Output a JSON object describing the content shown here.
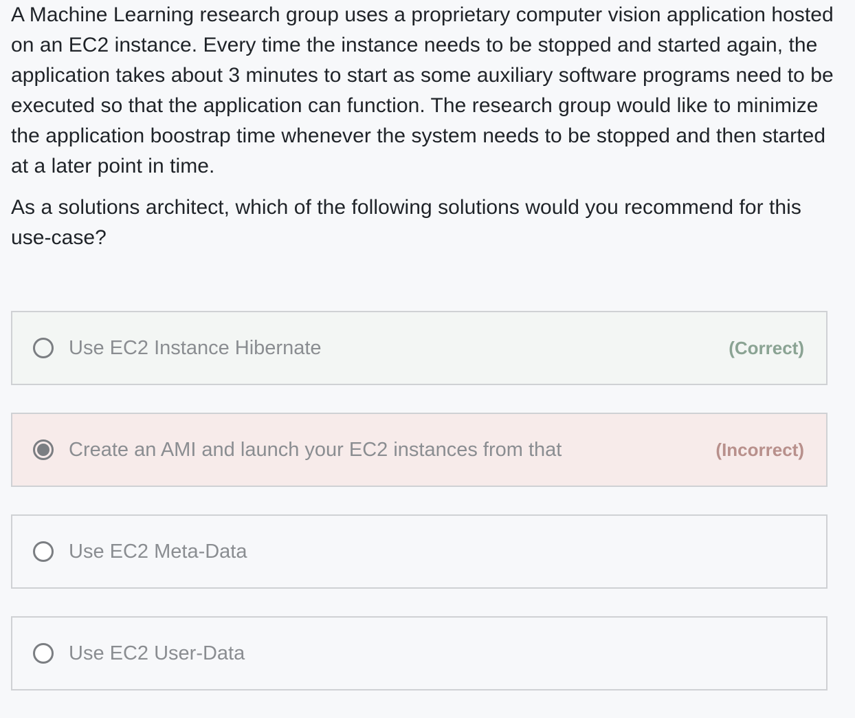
{
  "question": {
    "scenario": "A Machine Learning research group uses a proprietary computer vision application hosted on an EC2 instance. Every time the instance needs to be stopped and started again, the application takes about 3 minutes to start as some auxiliary software programs need to be executed so that the application can function. The research group would like to minimize the application boostrap time whenever the system needs to be stopped and then started at a later point in time.",
    "prompt": "As a solutions architect, which of the following solutions would you recommend for this use-case?"
  },
  "options": [
    {
      "label": "Use EC2 Instance Hibernate",
      "selected": false,
      "status": "correct",
      "verdict": "(Correct)"
    },
    {
      "label": "Create an AMI and launch your EC2 instances from that",
      "selected": true,
      "status": "incorrect",
      "verdict": "(Incorrect)"
    },
    {
      "label": "Use EC2 Meta-Data",
      "selected": false,
      "status": "none",
      "verdict": ""
    },
    {
      "label": "Use EC2 User-Data",
      "selected": false,
      "status": "none",
      "verdict": ""
    }
  ],
  "colors": {
    "correct_background": "#f3f6f4",
    "correct_text": "#8aa393",
    "incorrect_background": "#f7ebea",
    "incorrect_text": "#b8908c",
    "option_border": "#cfd1d4",
    "option_text": "#8a8d91"
  }
}
